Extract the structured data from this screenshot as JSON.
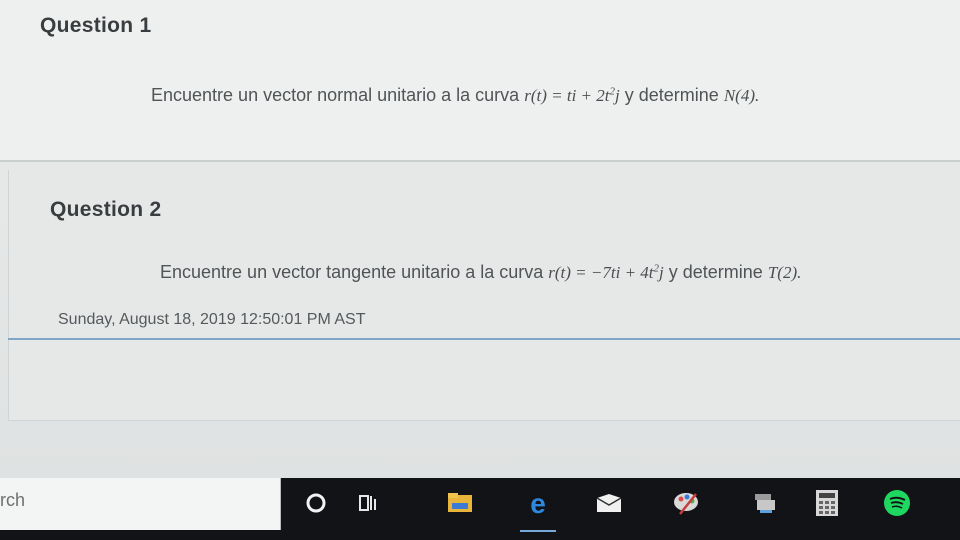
{
  "question1": {
    "title": "Question 1",
    "text": "Encuentre un vector normal unitario a la curva",
    "formula": "r(t) = ti + 2t",
    "formula_exp": "2",
    "formula_tail": "j",
    "suffix": "y determine",
    "target": "N(4)."
  },
  "question2": {
    "title": "Question 2",
    "text": "Encuentre un vector tangente unitario a la curva",
    "formula": "r(t) = −7ti + 4t",
    "formula_exp": "2",
    "formula_tail": "j",
    "suffix": "y determine",
    "target": "T(2)."
  },
  "timestamp": "Sunday, August 18, 2019 12:50:01 PM AST",
  "taskbar": {
    "search_text": "rch",
    "icons": [
      "cortana-icon",
      "task-view-icon",
      "file-explorer-icon",
      "edge-icon",
      "mail-icon",
      "paint-icon",
      "devices-icon",
      "calculator-icon",
      "spotify-icon"
    ]
  }
}
